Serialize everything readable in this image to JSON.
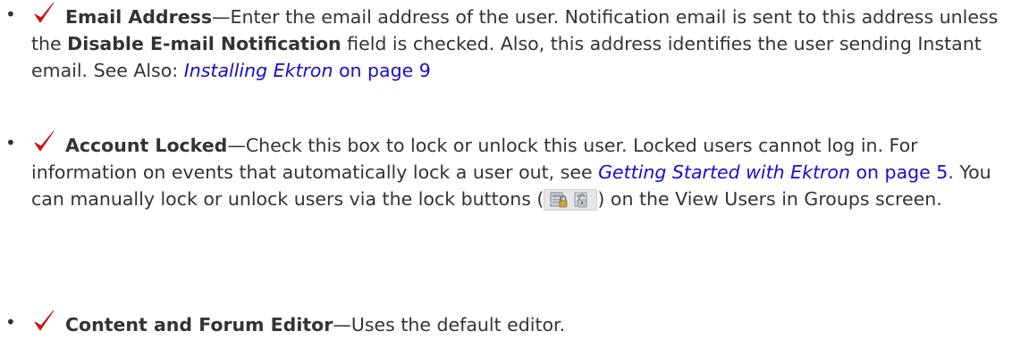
{
  "items": [
    {
      "icon": "checkmark-icon",
      "term": "Email Address",
      "dash": "—",
      "text_1": "Enter the email address of the user. Notification email is sent to this address unless the ",
      "bold_inline": "Disable E-mail Notification",
      "text_2": " field is checked. Also, this address identifies the user sending Instant email. See Also: ",
      "link": {
        "title": "Installing Ektron",
        "suffix": " on page 9"
      }
    },
    {
      "icon": "checkmark-icon",
      "term": "Account Locked",
      "dash": "—",
      "text_1": "Check this box to lock or unlock this user. Locked users cannot log in. For information on events that automatically lock a user out, see ",
      "link": {
        "title": "Getting Started with Ektron",
        "suffix": " on page 5"
      },
      "text_2": ". You can manually lock or unlock users via the lock buttons (",
      "lock_icons": [
        "lock-icon",
        "unlock-icon"
      ],
      "text_3": ") on the View Users in Groups screen."
    },
    {
      "icon": "checkmark-icon",
      "term": "Content and Forum Editor",
      "dash": "—",
      "text_1": "Uses the default editor."
    }
  ],
  "colors": {
    "text": "#333333",
    "link": "#1a0dcc",
    "checkmark": "#e01010"
  },
  "bullet_char": "•"
}
